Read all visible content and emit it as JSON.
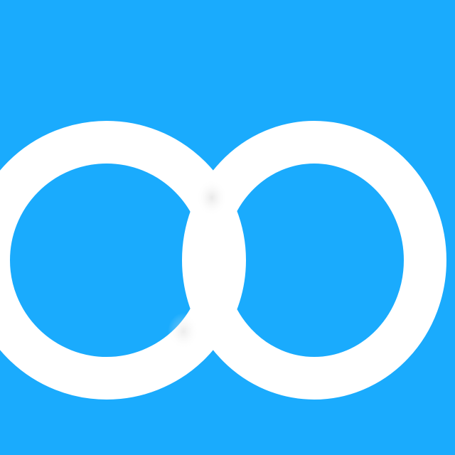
{
  "icon": {
    "name": "infinity-logo-icon",
    "background_color": "#1AABFD",
    "ring_color": "#FFFFFF",
    "overlap_shadow_color": "#E8E8E8"
  }
}
